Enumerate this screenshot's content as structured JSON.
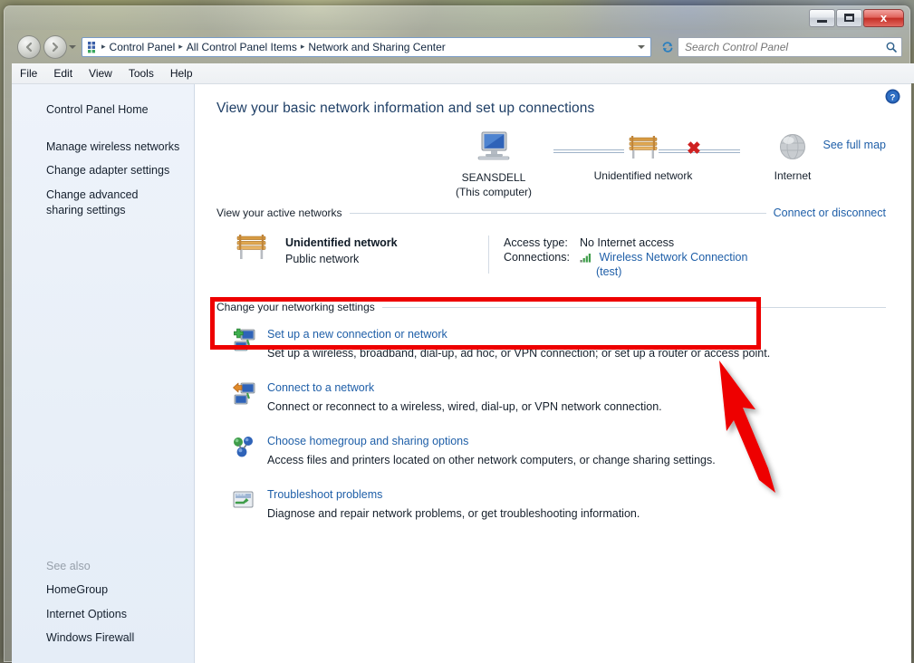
{
  "window": {
    "controls": {
      "minimize_label": "Minimize",
      "maximize_label": "Maximize",
      "close_label": "x"
    }
  },
  "toolbar": {
    "back_label": "Back",
    "forward_label": "Forward",
    "recent_pages_label": "Recent pages",
    "breadcrumbs": [
      {
        "label": "Control Panel"
      },
      {
        "label": "All Control Panel Items"
      },
      {
        "label": "Network and Sharing Center"
      }
    ],
    "separator": "▸",
    "refresh_label": "Refresh",
    "search": {
      "placeholder": "Search Control Panel",
      "value": ""
    }
  },
  "menubar": {
    "items": [
      {
        "label": "File"
      },
      {
        "label": "Edit"
      },
      {
        "label": "View"
      },
      {
        "label": "Tools"
      },
      {
        "label": "Help"
      }
    ]
  },
  "sidebar": {
    "home_label": "Control Panel Home",
    "items": [
      {
        "label": "Manage wireless networks"
      },
      {
        "label": "Change adapter settings"
      },
      {
        "label": "Change advanced sharing settings"
      }
    ],
    "see_also": {
      "title": "See also",
      "items": [
        {
          "label": "HomeGroup"
        },
        {
          "label": "Internet Options"
        },
        {
          "label": "Windows Firewall"
        }
      ]
    }
  },
  "content": {
    "help_label": "Help",
    "heading": "View your basic network information and set up connections",
    "map": {
      "see_full_map": "See full map",
      "nodes": [
        {
          "icon": "computer-icon",
          "label": "SEANSDELL",
          "sublabel": "(This computer)"
        },
        {
          "icon": "network-bench-icon",
          "label": "Unidentified network",
          "sublabel": ""
        },
        {
          "icon": "globe-icon",
          "label": "Internet",
          "sublabel": ""
        }
      ],
      "broken_link_marker": "✖"
    },
    "active_networks": {
      "section_label": "View your active networks",
      "right_link": "Connect or disconnect",
      "network_name": "Unidentified network",
      "network_type": "Public network",
      "details": [
        {
          "key": "Access type:",
          "value": "No Internet access",
          "is_link": false
        },
        {
          "key": "Connections:",
          "value": "Wireless Network Connection",
          "value2": "(test)",
          "is_link": true,
          "icon": "wifi-signal-icon"
        }
      ]
    },
    "settings": {
      "section_label": "Change your networking settings",
      "tasks": [
        {
          "icon": "new-connection-icon",
          "link": "Set up a new connection or network",
          "description": "Set up a wireless, broadband, dial-up, ad hoc, or VPN connection; or set up a router or access point.",
          "highlighted": true
        },
        {
          "icon": "connect-network-icon",
          "link": "Connect to a network",
          "description": "Connect or reconnect to a wireless, wired, dial-up, or VPN network connection.",
          "highlighted": false
        },
        {
          "icon": "homegroup-icon",
          "link": "Choose homegroup and sharing options",
          "description": "Access files and printers located on other network computers, or change sharing settings.",
          "highlighted": false
        },
        {
          "icon": "troubleshoot-icon",
          "link": "Troubleshoot problems",
          "description": "Diagnose and repair network problems, or get troubleshooting information.",
          "highlighted": false
        }
      ]
    }
  },
  "annotations": {
    "highlight_color": "#ee0000",
    "box_target": "Set up a new connection or network",
    "arrow_name": "red-pointer-arrow"
  }
}
